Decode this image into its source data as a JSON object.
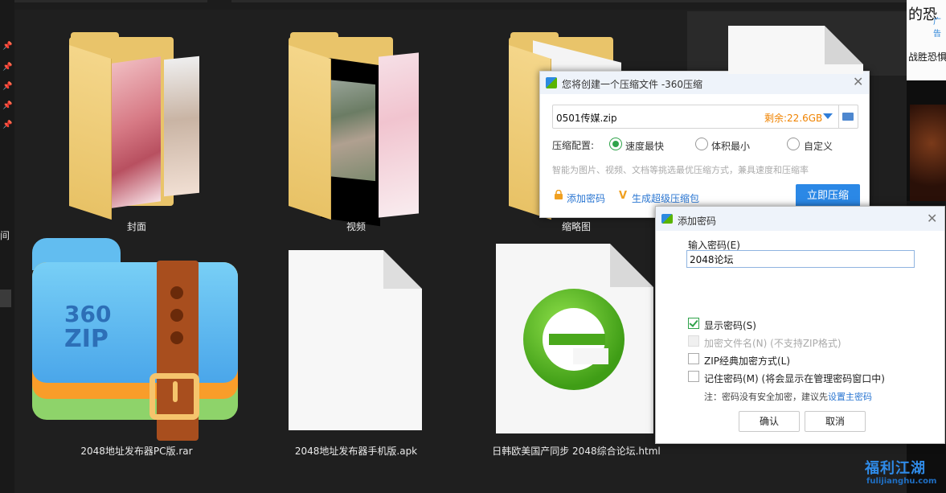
{
  "explorer": {
    "items": [
      {
        "label": "封面",
        "icon": "folder-icon"
      },
      {
        "label": "视频",
        "icon": "folder-icon"
      },
      {
        "label": "缩略图",
        "icon": "folder-icon"
      },
      {
        "label": "2048地址发布器PC版.rar",
        "icon": "360zip-archive-icon"
      },
      {
        "label": "2048地址发布器手机版.apk",
        "icon": "blank-file-icon"
      },
      {
        "label": "日韩欧美国产同步 2048综合论坛.html",
        "icon": "browser-ie-icon"
      }
    ],
    "thumb_texts": {
      "rar_logo_line1": "360",
      "rar_logo_line2": "ZIP"
    }
  },
  "left_strip": {
    "text": "间"
  },
  "right_page": {
    "headline": "的恐",
    "ad": "广告",
    "subline": "战胜恐惧"
  },
  "compress_dialog": {
    "title": "您将创建一个压缩文件 -360压缩",
    "filename": "0501传媒.zip",
    "remaining": "剩余:22.6GB",
    "config_label": "压缩配置:",
    "options": [
      "速度最快",
      "体积最小",
      "自定义"
    ],
    "selected_option": "速度最快",
    "hint": "智能为图片、视频、文档等挑选最优压缩方式，兼具速度和压缩率",
    "add_password": "添加密码",
    "make_super": "生成超级压缩包",
    "compress_now": "立即压缩"
  },
  "password_dialog": {
    "title": "添加密码",
    "input_label": "输入密码(E)",
    "password_value": "2048论坛",
    "checkboxes": [
      {
        "label": "显示密码(S)",
        "checked": true,
        "disabled": false
      },
      {
        "label": "加密文件名(N) (不支持ZIP格式)",
        "checked": false,
        "disabled": true
      },
      {
        "label": "ZIP经典加密方式(L)",
        "checked": false,
        "disabled": false
      },
      {
        "label": "记住密码(M) (将会显示在管理密码窗口中)",
        "checked": false,
        "disabled": false
      }
    ],
    "note_prefix": "注：密码没有安全加密，建议先",
    "note_link": "设置主密码",
    "ok": "确认",
    "cancel": "取消"
  },
  "watermark": {
    "line1": "福利江湖",
    "line2": "fulijianghu.com"
  },
  "colors": {
    "accent_blue": "#2b88e6",
    "orange_text": "#f08300",
    "check_green": "#2fa34a",
    "folder_yellow": "#e9c46a"
  }
}
